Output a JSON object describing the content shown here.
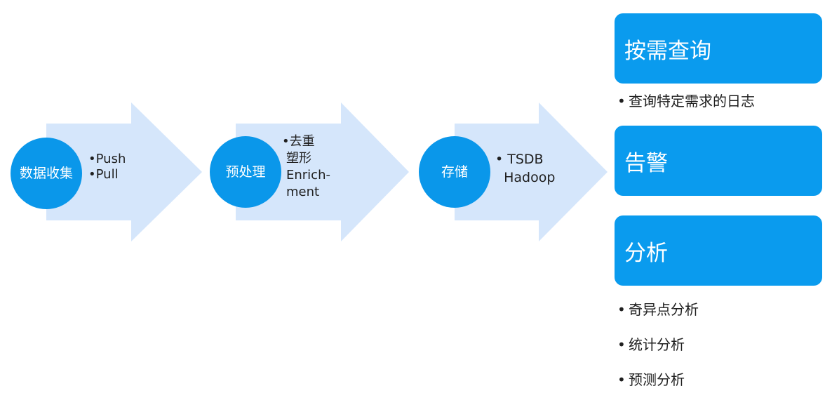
{
  "colors": {
    "arrow": "#d5e6fb",
    "circle": "#0a97ea",
    "box": "#0a9bee"
  },
  "steps": [
    {
      "circle": "数据收集",
      "bullets": [
        "•Push",
        "•Pull"
      ]
    },
    {
      "circle": "预处理",
      "bullets": [
        "•去重",
        "塑形",
        "Enrich-",
        "ment"
      ]
    },
    {
      "circle": "存储",
      "bullets": [
        "• TSDB",
        "  Hadoop"
      ]
    }
  ],
  "outputs": [
    {
      "title": "按需查询",
      "items": [
        "查询特定需求的日志"
      ]
    },
    {
      "title": "告警",
      "items": []
    },
    {
      "title": "分析",
      "items": [
        "奇异点分析",
        "统计分析",
        "预测分析"
      ]
    }
  ]
}
